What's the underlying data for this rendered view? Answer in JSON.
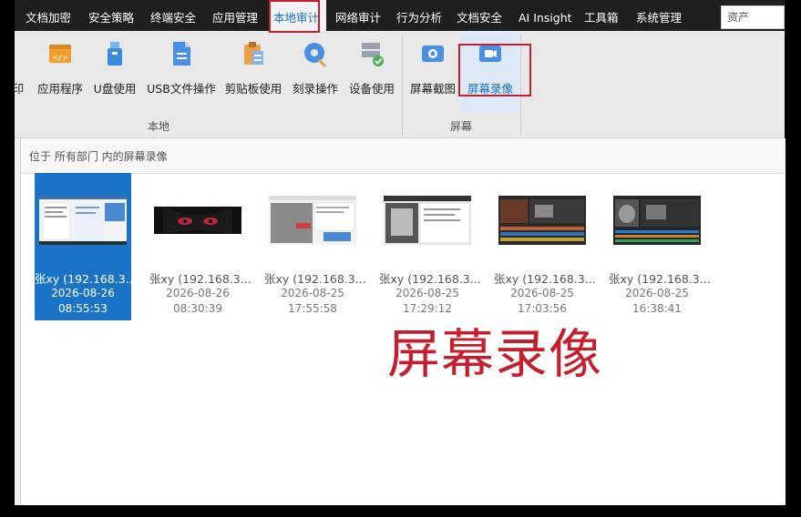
{
  "tabs": [
    "文档加密",
    "安全策略",
    "终端安全",
    "应用管理",
    "本地审计",
    "网络审计",
    "行为分析",
    "文档安全",
    "AI Insight",
    "工具箱",
    "系统管理"
  ],
  "active_tab": "本地审计",
  "search": {
    "value": "资产"
  },
  "ribbon": {
    "partial_label": "印",
    "local_items": [
      "应用程序",
      "U盘使用",
      "USB文件操作",
      "剪贴板使用",
      "刻录操作",
      "设备使用"
    ],
    "screen_items": [
      "屏幕截图",
      "屏幕录像"
    ],
    "selected_item": "屏幕录像",
    "group_local": "本地",
    "group_screen": "屏幕"
  },
  "path": "位于 所有部门 内的屏幕录像",
  "recordings": [
    {
      "name": "张xy (192.168.3...",
      "date": "2026-08-26",
      "time": "08:55:53",
      "selected": true
    },
    {
      "name": "张xy (192.168.3...",
      "date": "2026-08-26",
      "time": "08:30:39",
      "selected": false
    },
    {
      "name": "张xy (192.168.3...",
      "date": "2026-08-25",
      "time": "17:55:58",
      "selected": false
    },
    {
      "name": "张xy (192.168.3...",
      "date": "2026-08-25",
      "time": "17:29:12",
      "selected": false
    },
    {
      "name": "张xy (192.168.3...",
      "date": "2026-08-25",
      "time": "17:03:56",
      "selected": false
    },
    {
      "name": "张xy (192.168.3...",
      "date": "2026-08-25",
      "time": "16:38:41",
      "selected": false
    }
  ],
  "annotation": "屏幕录像",
  "colors": {
    "accent": "#1a73c7",
    "highlight": "#c41f2f",
    "tabbar": "#1f1f1f"
  }
}
